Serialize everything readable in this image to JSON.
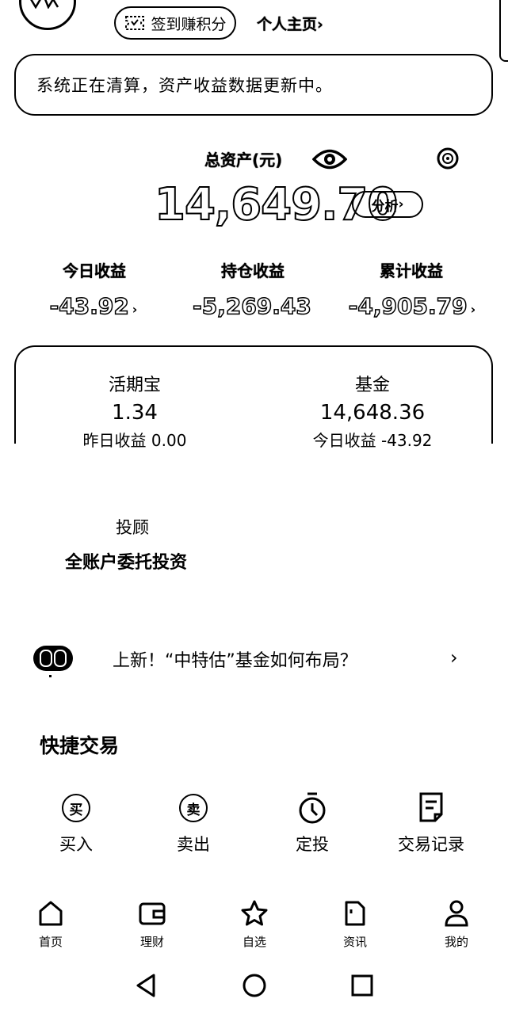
{
  "header": {
    "sign_in_label": "签到赚积分",
    "profile_label": "个人主页",
    "profile_arrow": "›"
  },
  "notice": {
    "text": "系统正在清算，资产收益数据更新中。"
  },
  "total_assets": {
    "label": "总资产(元)",
    "value": "14,649.70",
    "analyze_label": "分析",
    "analyze_arrow": "›"
  },
  "earnings": [
    {
      "label": "今日收益",
      "value": "-43.92",
      "arrow": "›"
    },
    {
      "label": "持仓收益",
      "value": "-5,269.43",
      "arrow": ""
    },
    {
      "label": "累计收益",
      "value": "-4,905.79",
      "arrow": "›"
    }
  ],
  "asset_card": {
    "left": {
      "title": "活期宝",
      "value": "1.34",
      "sub_label": "昨日收益",
      "sub_value": "0.00"
    },
    "right": {
      "title": "基金",
      "value": "14,648.36",
      "sub_label": "今日收益",
      "sub_value": "-43.92"
    }
  },
  "advisor": {
    "title": "投顾",
    "desc": "全账户委托投资"
  },
  "news": {
    "text": "上新！“中特估”基金如何布局？",
    "arrow": "›"
  },
  "quick_trade": {
    "title": "快捷交易",
    "items": [
      {
        "label": "买入",
        "icon": "buy-icon",
        "icon_char": "买"
      },
      {
        "label": "卖出",
        "icon": "sell-icon",
        "icon_char": "卖"
      },
      {
        "label": "定投",
        "icon": "timer-icon"
      },
      {
        "label": "交易记录",
        "icon": "records-icon"
      }
    ]
  },
  "bottom_nav": [
    {
      "label": "首页",
      "icon": "home-icon"
    },
    {
      "label": "理财",
      "icon": "wallet-icon"
    },
    {
      "label": "自选",
      "icon": "star-icon"
    },
    {
      "label": "资讯",
      "icon": "document-icon"
    },
    {
      "label": "我的",
      "icon": "user-icon"
    }
  ],
  "system_nav": [
    "back",
    "home",
    "recents"
  ]
}
